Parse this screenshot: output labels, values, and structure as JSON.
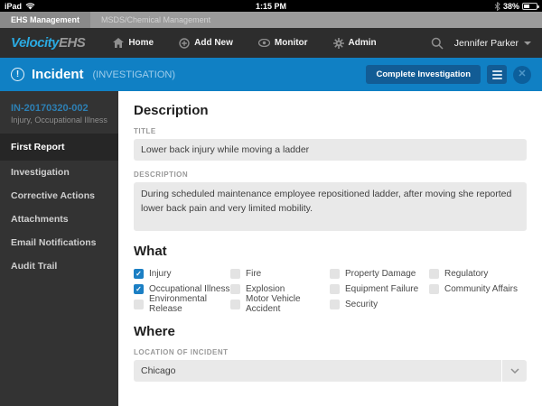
{
  "status_bar": {
    "device": "iPad",
    "time": "1:15 PM",
    "battery": "38%"
  },
  "product_tabs": {
    "tab1": "EHS Management",
    "tab2": "MSDS/Chemical Management"
  },
  "nav_bar": {
    "logo_part1": "Velocity",
    "logo_part2": "EHS",
    "home": "Home",
    "add_new": "Add New",
    "monitor": "Monitor",
    "admin": "Admin",
    "user_name": "Jennifer Parker"
  },
  "incident_header": {
    "title": "Incident",
    "subtitle": "(INVESTIGATION)",
    "complete_button": "Complete Investigation"
  },
  "sidebar": {
    "record_id": "IN-20170320-002",
    "record_type": "Injury, Occupational Illness",
    "items": [
      {
        "label": "First Report",
        "active": true
      },
      {
        "label": "Investigation",
        "active": false
      },
      {
        "label": "Corrective Actions",
        "active": false
      },
      {
        "label": "Attachments",
        "active": false
      },
      {
        "label": "Email Notifications",
        "active": false
      },
      {
        "label": "Audit Trail",
        "active": false
      }
    ]
  },
  "main": {
    "description_section": {
      "heading": "Description",
      "title_label": "TITLE",
      "title_value": "Lower back injury while moving a ladder",
      "description_label": "DESCRIPTION",
      "description_value": "During scheduled maintenance employee repositioned ladder, after moving she reported lower back pain and very limited mobility."
    },
    "what_section": {
      "heading": "What",
      "columns": [
        {
          "items": [
            {
              "label": "Injury",
              "checked": true
            },
            {
              "label": "Occupational Illness",
              "checked": true
            },
            {
              "label": "Environmental Release",
              "checked": false
            }
          ]
        },
        {
          "items": [
            {
              "label": "Fire",
              "checked": false
            },
            {
              "label": "Explosion",
              "checked": false
            },
            {
              "label": "Motor Vehicle Accident",
              "checked": false
            }
          ]
        },
        {
          "items": [
            {
              "label": "Property Damage",
              "checked": false
            },
            {
              "label": "Equipment Failure",
              "checked": false
            },
            {
              "label": "Security",
              "checked": false
            }
          ]
        },
        {
          "items": [
            {
              "label": "Regulatory",
              "checked": false
            },
            {
              "label": "Community Affairs",
              "checked": false
            }
          ]
        }
      ]
    },
    "where_section": {
      "heading": "Where",
      "location_label": "LOCATION OF INCIDENT",
      "location_value": "Chicago"
    }
  },
  "colors": {
    "header_blue": "#1080c4",
    "brand_blue": "#2aa9e0",
    "checkbox_blue": "#1b7fc4",
    "sidebar_dark": "#333333",
    "record_id_blue": "#2d7fb3"
  }
}
